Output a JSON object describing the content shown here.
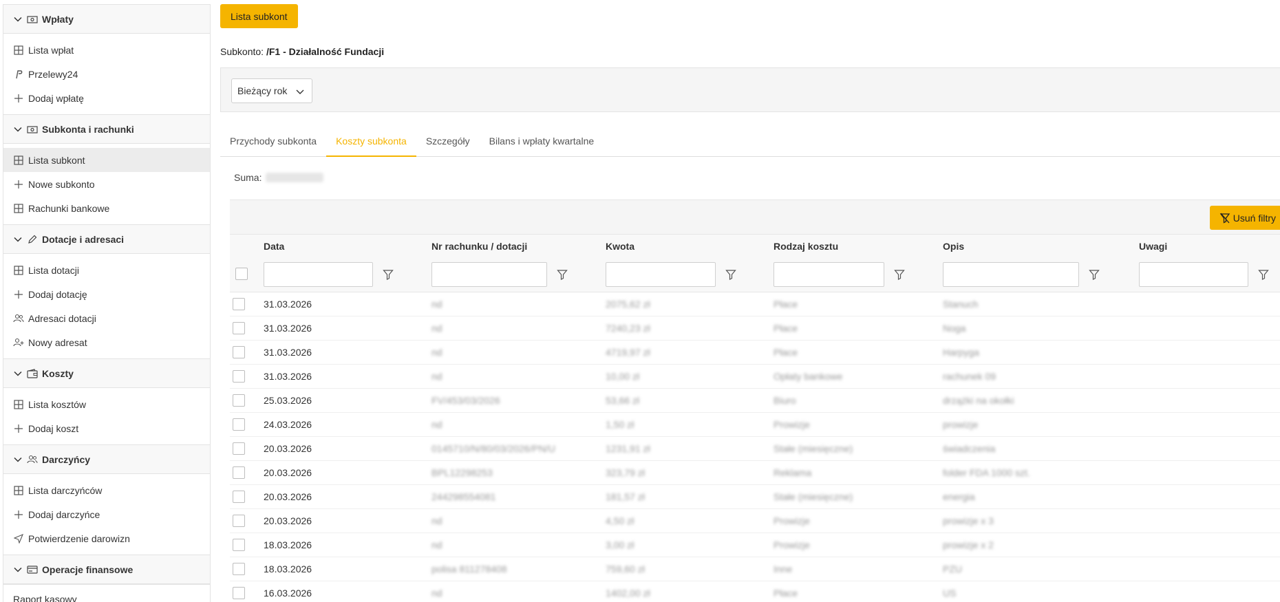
{
  "sidebar": {
    "sections": [
      {
        "title": "Wpłaty",
        "icon": "wallet-cash-icon",
        "items": [
          {
            "label": "Lista wpłat",
            "icon": "table-icon"
          },
          {
            "label": "Przelewy24",
            "icon": "paypal-icon"
          },
          {
            "label": "Dodaj wpłatę",
            "icon": "plus-icon"
          }
        ]
      },
      {
        "title": "Subkonta i rachunki",
        "icon": "wallet-cash-icon",
        "items": [
          {
            "label": "Lista subkont",
            "icon": "table-icon",
            "active": true
          },
          {
            "label": "Nowe subkonto",
            "icon": "plus-icon"
          },
          {
            "label": "Rachunki bankowe",
            "icon": "table-icon"
          }
        ]
      },
      {
        "title": "Dotacje i adresaci",
        "icon": "pencil-icon",
        "items": [
          {
            "label": "Lista dotacji",
            "icon": "table-icon"
          },
          {
            "label": "Dodaj dotację",
            "icon": "plus-icon"
          },
          {
            "label": "Adresaci dotacji",
            "icon": "users-icon"
          },
          {
            "label": "Nowy adresat",
            "icon": "user-plus-icon"
          }
        ]
      },
      {
        "title": "Koszty",
        "icon": "wallet-icon",
        "items": [
          {
            "label": "Lista kosztów",
            "icon": "table-icon"
          },
          {
            "label": "Dodaj koszt",
            "icon": "plus-icon"
          }
        ]
      },
      {
        "title": "Darczyńcy",
        "icon": "users-icon",
        "items": [
          {
            "label": "Lista darczyńców",
            "icon": "table-icon"
          },
          {
            "label": "Dodaj darczyńce",
            "icon": "plus-icon"
          },
          {
            "label": "Potwierdzenie darowizn",
            "icon": "send-icon"
          }
        ]
      },
      {
        "title": "Operacje finansowe",
        "icon": "card-icon",
        "items": []
      }
    ],
    "footer_item": "Raport kasowy"
  },
  "main": {
    "top_button": "Lista subkont",
    "subkonto_label": "Subkonto:",
    "subkonto_value": "/F1 - Działalność Fundacji",
    "period_select": "Bieżący rok",
    "tabs": [
      {
        "label": "Przychody subkonta",
        "active": false
      },
      {
        "label": "Koszty subkonta",
        "active": true
      },
      {
        "label": "Szczegóły",
        "active": false
      },
      {
        "label": "Bilans i wpłaty kwartalne",
        "active": false
      }
    ],
    "suma_label": "Suma:",
    "clear_filters": "Usuń filtry",
    "columns": [
      "Data",
      "Nr rachunku / dotacji",
      "Kwota",
      "Rodzaj kosztu",
      "Opis",
      "Uwagi"
    ],
    "rows": [
      {
        "data": "31.03.2026",
        "nr": "nd",
        "kwota": "2075,62 zł",
        "rodzaj": "Płace",
        "opis": "Stanuch"
      },
      {
        "data": "31.03.2026",
        "nr": "nd",
        "kwota": "7240,23 zł",
        "rodzaj": "Płace",
        "opis": "Noga"
      },
      {
        "data": "31.03.2026",
        "nr": "nd",
        "kwota": "4719,97 zł",
        "rodzaj": "Płace",
        "opis": "Harpyga"
      },
      {
        "data": "31.03.2026",
        "nr": "nd",
        "kwota": "10,00 zł",
        "rodzaj": "Opłaty bankowe",
        "opis": "rachunek 09"
      },
      {
        "data": "25.03.2026",
        "nr": "FV/453/03/2026",
        "kwota": "53,66 zł",
        "rodzaj": "Biuro",
        "opis": "drzążki na okołki"
      },
      {
        "data": "24.03.2026",
        "nr": "nd",
        "kwota": "1,50 zł",
        "rodzaj": "Prowizje",
        "opis": "prowizje"
      },
      {
        "data": "20.03.2026",
        "nr": "0145710/N/80/03/2026/PN/U",
        "kwota": "1231,91 zł",
        "rodzaj": "Stałe (miesięczne)",
        "opis": "świadczenia"
      },
      {
        "data": "20.03.2026",
        "nr": "BPL12298253",
        "kwota": "323,79 zł",
        "rodzaj": "Reklama",
        "opis": "folder FDA 1000 szt."
      },
      {
        "data": "20.03.2026",
        "nr": "244298554081",
        "kwota": "181,57 zł",
        "rodzaj": "Stałe (miesięczne)",
        "opis": "energia"
      },
      {
        "data": "20.03.2026",
        "nr": "nd",
        "kwota": "4,50 zł",
        "rodzaj": "Prowizje",
        "opis": "prowizje x 3"
      },
      {
        "data": "18.03.2026",
        "nr": "nd",
        "kwota": "3,00 zł",
        "rodzaj": "Prowizje",
        "opis": "prowizje x 2"
      },
      {
        "data": "18.03.2026",
        "nr": "polisa 811278408",
        "kwota": "759,60 zł",
        "rodzaj": "Inne",
        "opis": "PZU"
      },
      {
        "data": "16.03.2026",
        "nr": "nd",
        "kwota": "1402,00 zł",
        "rodzaj": "Płace",
        "opis": "US"
      }
    ]
  },
  "colors": {
    "accent": "#f5b400",
    "sidebar_active": "#ececec",
    "panel_bg": "#f5f5f5"
  }
}
